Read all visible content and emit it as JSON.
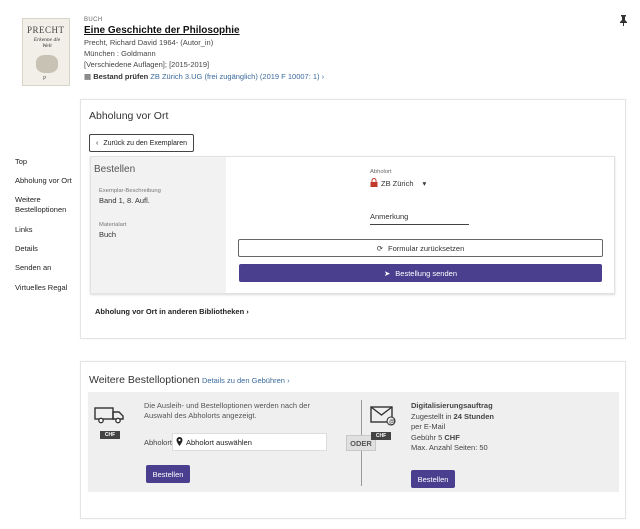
{
  "book": {
    "cover_name": "PRECHT",
    "cover_subtitle": "Erkenne die Welt",
    "cover_publisher": "P",
    "type": "BUCH",
    "title_prefix": "Eine ",
    "title_rest": "Geschichte der Philosophie",
    "author": "Precht, Richard David 1964- (Autor_in)",
    "publisher": "München : Goldmann",
    "edition": "[Verschiedene Auflagen]; [2015-2019]",
    "availability_label": "Bestand prüfen",
    "availability_link": "ZB Zürich  3.UG (frei zugänglich) (2019 F 10007: 1)",
    "availability_arrow": "›"
  },
  "sidebar": {
    "items": [
      {
        "label": "Top"
      },
      {
        "label": "Abholung vor Ort"
      },
      {
        "label": "Weitere Bestelloptionen"
      },
      {
        "label": "Links"
      },
      {
        "label": "Details"
      },
      {
        "label": "Senden an"
      },
      {
        "label": "Virtuelles Regal"
      }
    ]
  },
  "pickup": {
    "title": "Abholung vor Ort",
    "back_label": "Zurück zu den Exemplaren",
    "order_heading": "Bestellen",
    "item_desc_label": "Exemplar-Beschreibung",
    "item_desc_value": "Band 1, 8. Aufl.",
    "material_label": "Materialart",
    "material_value": "Buch",
    "pickup_location_label": "Abholort",
    "pickup_location_value": "ZB Zürich",
    "remark_label": "Anmerkung",
    "reset_label": "Formular zurücksetzen",
    "send_label": "Bestellung senden",
    "other_libraries": "Abholung vor Ort in anderen Bibliotheken"
  },
  "more_options": {
    "title": "Weitere Bestelloptionen",
    "fee_link": "Details zu den Gebühren",
    "fee_arrow": "›",
    "chf": "CHF",
    "description": "Die Ausleih- und Bestelloptionen werden nach der Auswahl des Abholorts angezeigt.",
    "pickup_label": "Abholort",
    "pickup_placeholder": "Abholort auswählen",
    "order_button": "Bestellen",
    "or_label": "ODER",
    "digitization": {
      "title": "Digitalisierungsauftrag",
      "delivery_prefix": "Zugestellt in ",
      "delivery_time": "24 Stunden",
      "delivery_method": "per E-Mail",
      "fee_prefix": "Gebühr  5 ",
      "fee_currency": "CHF",
      "max_pages": "Max. Anzahl Seiten: 50",
      "order_button": "Bestellen"
    }
  },
  "colors": {
    "accent": "#4a3f8f",
    "link": "#3a6a9c"
  }
}
